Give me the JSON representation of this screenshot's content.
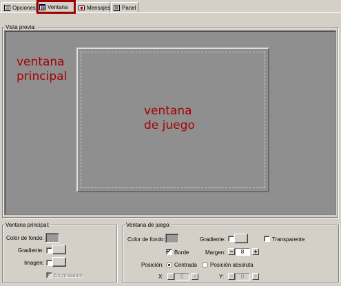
{
  "tabs": [
    {
      "label": "Opciones",
      "icon": "options-icon"
    },
    {
      "label": "Ventana",
      "icon": "window-icon",
      "active": true
    },
    {
      "label": "Mensajes",
      "icon": "messages-icon"
    },
    {
      "label": "Panel",
      "icon": "panel-icon"
    }
  ],
  "preview": {
    "legend": "Vista previa:",
    "main_window_label_line1": "ventana",
    "main_window_label_line2": "principal",
    "game_window_label_line1": "ventana",
    "game_window_label_line2": "de juego",
    "annotation_color": "#a80000",
    "background_color": "#8f8f8f"
  },
  "main_window": {
    "legend": "Ventana principal:",
    "bg_color_label": "Color de fondo:",
    "bg_color_value": "#9a9a9a",
    "gradient_label": "Gradiente:",
    "image_label": "Imagen:",
    "tile_label": "En mosaico"
  },
  "game_window": {
    "legend": "Ventana de juego:",
    "bg_color_label": "Color de fondo:",
    "bg_color_value": "#9a9a9a",
    "gradient_label": "Gradiente:",
    "transparent_label": "Transparente",
    "border_label": "Borde",
    "margin_label": "Margen:",
    "margin_value": "8",
    "position_label": "Posición:",
    "centered_label": "Centrada",
    "absolute_label": "Posición absoluta",
    "x_label": "X:",
    "x_value": "0",
    "y_label": "Y:",
    "y_value": "0"
  },
  "highlight_color": "#a00000"
}
